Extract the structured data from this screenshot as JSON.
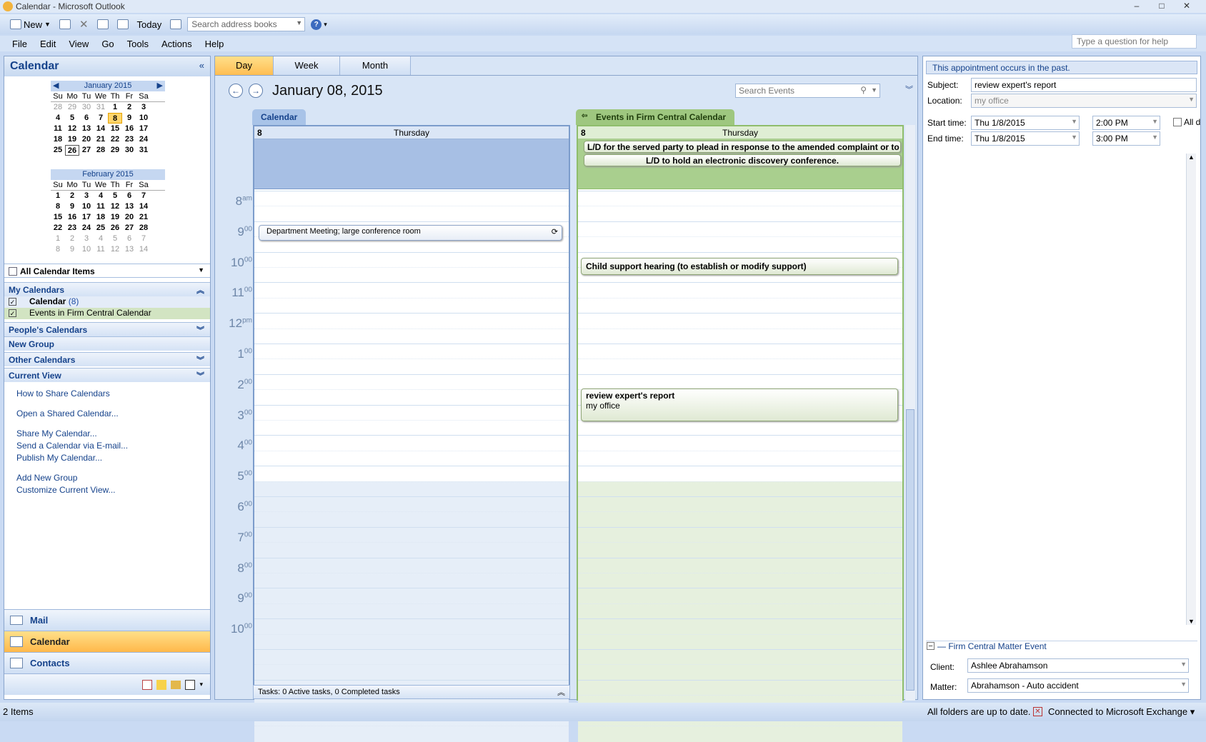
{
  "window": {
    "title": "Calendar - Microsoft Outlook"
  },
  "toolbar": {
    "new_label": "New",
    "today_label": "Today",
    "search_placeholder": "Search address books"
  },
  "menu": [
    "File",
    "Edit",
    "View",
    "Go",
    "Tools",
    "Actions",
    "Help"
  ],
  "help_placeholder": "Type a question for help",
  "nav": {
    "title": "Calendar",
    "jan": {
      "title": "January 2015",
      "weeks": [
        [
          "28",
          "29",
          "30",
          "31",
          "1",
          "2",
          "3"
        ],
        [
          "4",
          "5",
          "6",
          "7",
          "8",
          "9",
          "10"
        ],
        [
          "11",
          "12",
          "13",
          "14",
          "15",
          "16",
          "17"
        ],
        [
          "18",
          "19",
          "20",
          "21",
          "22",
          "23",
          "24"
        ],
        [
          "25",
          "26",
          "27",
          "28",
          "29",
          "30",
          "31"
        ]
      ]
    },
    "feb": {
      "title": "February 2015",
      "weeks": [
        [
          "1",
          "2",
          "3",
          "4",
          "5",
          "6",
          "7"
        ],
        [
          "8",
          "9",
          "10",
          "11",
          "12",
          "13",
          "14"
        ],
        [
          "15",
          "16",
          "17",
          "18",
          "19",
          "20",
          "21"
        ],
        [
          "22",
          "23",
          "24",
          "25",
          "26",
          "27",
          "28"
        ],
        [
          "1",
          "2",
          "3",
          "4",
          "5",
          "6",
          "7"
        ],
        [
          "8",
          "9",
          "10",
          "11",
          "12",
          "13",
          "14"
        ]
      ]
    },
    "dow": [
      "Su",
      "Mo",
      "Tu",
      "We",
      "Th",
      "Fr",
      "Sa"
    ],
    "all_items": "All Calendar Items",
    "my_calendars": "My Calendars",
    "cal1": "Calendar",
    "cal1_count": "(8)",
    "cal2": "Events in Firm Central Calendar",
    "peoples": "People's Calendars",
    "new_group": "New Group",
    "other": "Other Calendars",
    "current_view": "Current View",
    "links": [
      "How to Share Calendars",
      "Open a Shared Calendar...",
      "Share My Calendar...",
      "Send a Calendar via E-mail...",
      "Publish My Calendar...",
      "Add New Group",
      "Customize Current View..."
    ],
    "mail": "Mail",
    "calendar": "Calendar",
    "contacts": "Contacts"
  },
  "view": {
    "tabs": [
      "Day",
      "Week",
      "Month"
    ],
    "date": "January 08, 2015",
    "search_placeholder": "Search Events",
    "cal_tab": "Calendar",
    "firm_tab": "Events in Firm Central Calendar",
    "daynum": "8",
    "dayname": "Thursday",
    "hours": [
      {
        "h": "8",
        "s": "am"
      },
      {
        "h": "9",
        "s": "00"
      },
      {
        "h": "10",
        "s": "00"
      },
      {
        "h": "11",
        "s": "00"
      },
      {
        "h": "12",
        "s": "pm"
      },
      {
        "h": "1",
        "s": "00"
      },
      {
        "h": "2",
        "s": "00"
      },
      {
        "h": "3",
        "s": "00"
      },
      {
        "h": "4",
        "s": "00"
      },
      {
        "h": "5",
        "s": "00"
      },
      {
        "h": "6",
        "s": "00"
      },
      {
        "h": "7",
        "s": "00"
      },
      {
        "h": "8",
        "s": "00"
      },
      {
        "h": "9",
        "s": "00"
      },
      {
        "h": "10",
        "s": "00"
      }
    ],
    "allday1": "L/D for the served party to plead in response to the amended complaint or to move",
    "allday2": "L/D to hold an electronic discovery conference.",
    "dept": "Department Meeting; large conference room",
    "child": "Child support hearing (to establish or modify support)",
    "review_title": "review expert's report",
    "review_loc": "my office",
    "tasks": "Tasks: 0 Active tasks, 0 Completed tasks"
  },
  "form": {
    "info": "This appointment occurs in the past.",
    "subject_lbl": "Subject:",
    "subject": "review expert's report",
    "location_lbl": "Location:",
    "location": "my office",
    "start_lbl": "Start time:",
    "start_date": "Thu 1/8/2015",
    "start_time": "2:00 PM",
    "allday": "All d",
    "end_lbl": "End time:",
    "end_date": "Thu 1/8/2015",
    "end_time": "3:00 PM",
    "section": "Firm Central Matter Event",
    "client_lbl": "Client:",
    "client": "Ashlee Abrahamson",
    "matter_lbl": "Matter:",
    "matter": "Abrahamson - Auto accident"
  },
  "status": {
    "items": "2 Items",
    "uptodate": "All folders are up to date.",
    "exchange": "Connected to Microsoft Exchange"
  }
}
